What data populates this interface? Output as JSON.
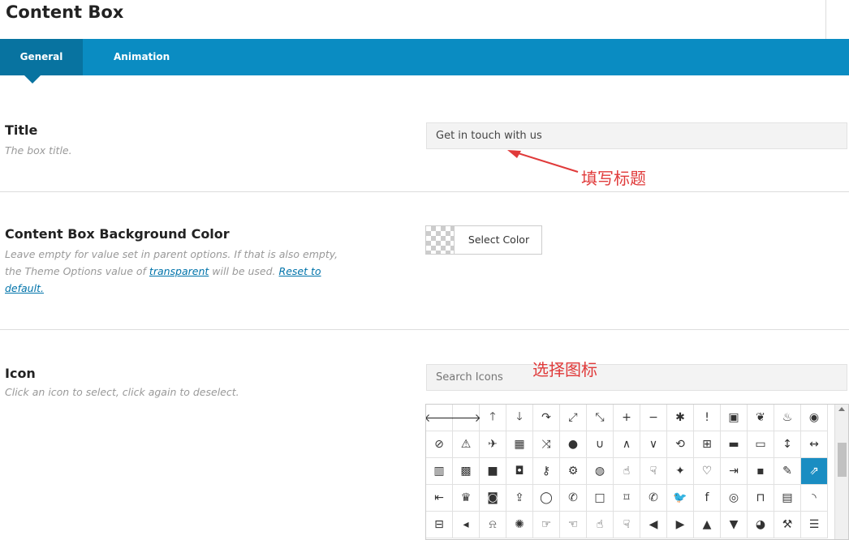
{
  "page": {
    "title": "Content Box"
  },
  "tabs": [
    {
      "label": "General",
      "active": true
    },
    {
      "label": "Animation",
      "active": false
    }
  ],
  "title_section": {
    "heading": "Title",
    "description": "The box title.",
    "value": "Get in touch with us",
    "annotation": "填写标题"
  },
  "bg_section": {
    "heading": "Content Box Background Color",
    "desc_part1": "Leave empty for value set in parent options. If that is also empty, the Theme Options value of ",
    "desc_link1": "transparent",
    "desc_part2": " will be used. ",
    "desc_link2": "Reset to default.",
    "button_label": "Select Color"
  },
  "icon_section": {
    "heading": "Icon",
    "description": "Click an icon to select, click again to deselect.",
    "search_placeholder": "Search Icons",
    "annotation": "选择图标",
    "selected_index": 44,
    "icons": [
      {
        "name": "arrow-left-icon",
        "glyph": "🡐"
      },
      {
        "name": "arrow-right-icon",
        "glyph": "🡒"
      },
      {
        "name": "arrow-up-icon",
        "glyph": "🡑"
      },
      {
        "name": "arrow-down-icon",
        "glyph": "🡓"
      },
      {
        "name": "share-icon",
        "glyph": "↷"
      },
      {
        "name": "expand-icon",
        "glyph": "⤢"
      },
      {
        "name": "compress-icon",
        "glyph": "⤡"
      },
      {
        "name": "plus-icon",
        "glyph": "+"
      },
      {
        "name": "minus-icon",
        "glyph": "−"
      },
      {
        "name": "asterisk-icon",
        "glyph": "✱"
      },
      {
        "name": "exclamation-circle-icon",
        "glyph": "!"
      },
      {
        "name": "gift-icon",
        "glyph": "▣"
      },
      {
        "name": "leaf-icon",
        "glyph": "❦"
      },
      {
        "name": "fire-icon",
        "glyph": "♨"
      },
      {
        "name": "eye-icon",
        "glyph": "◉"
      },
      {
        "name": "eye-slash-icon",
        "glyph": "⊘"
      },
      {
        "name": "warning-icon",
        "glyph": "⚠"
      },
      {
        "name": "plane-icon",
        "glyph": "✈"
      },
      {
        "name": "calendar-icon",
        "glyph": "▦"
      },
      {
        "name": "random-icon",
        "glyph": "⤨"
      },
      {
        "name": "comment-icon",
        "glyph": "●"
      },
      {
        "name": "magnet-icon",
        "glyph": "∪"
      },
      {
        "name": "chevron-up-icon",
        "glyph": "∧"
      },
      {
        "name": "chevron-down-icon",
        "glyph": "∨"
      },
      {
        "name": "retweet-icon",
        "glyph": "⟲"
      },
      {
        "name": "shopping-cart-icon",
        "glyph": "⊞"
      },
      {
        "name": "folder-icon",
        "glyph": "▬"
      },
      {
        "name": "folder-open-icon",
        "glyph": "▭"
      },
      {
        "name": "arrows-v-icon",
        "glyph": "↕"
      },
      {
        "name": "arrows-h-icon",
        "glyph": "↔"
      },
      {
        "name": "bar-chart-icon",
        "glyph": "▥"
      },
      {
        "name": "twitter-square-icon",
        "glyph": "▩"
      },
      {
        "name": "facebook-square-icon",
        "glyph": "■"
      },
      {
        "name": "camera-retro-icon",
        "glyph": "◘"
      },
      {
        "name": "key-icon",
        "glyph": "⚷"
      },
      {
        "name": "cogs-icon",
        "glyph": "⚙"
      },
      {
        "name": "comments-icon",
        "glyph": "◍"
      },
      {
        "name": "thumbs-o-up-icon",
        "glyph": "☝"
      },
      {
        "name": "thumbs-o-down-icon",
        "glyph": "☟"
      },
      {
        "name": "star-half-icon",
        "glyph": "✦"
      },
      {
        "name": "heart-o-icon",
        "glyph": "♡"
      },
      {
        "name": "sign-out-icon",
        "glyph": "⇥"
      },
      {
        "name": "linkedin-square-icon",
        "glyph": "▪"
      },
      {
        "name": "thumb-tack-icon",
        "glyph": "✎"
      },
      {
        "name": "external-link-icon",
        "glyph": "⇗"
      },
      {
        "name": "sign-in-icon",
        "glyph": "⇤"
      },
      {
        "name": "trophy-icon",
        "glyph": "♛"
      },
      {
        "name": "github-square-icon",
        "glyph": "◙"
      },
      {
        "name": "upload-icon",
        "glyph": "⇪"
      },
      {
        "name": "lemon-icon",
        "glyph": "◯"
      },
      {
        "name": "phone-icon",
        "glyph": "✆"
      },
      {
        "name": "square-o-icon",
        "glyph": "□"
      },
      {
        "name": "bookmark-o-icon",
        "glyph": "⌑"
      },
      {
        "name": "phone-square-icon",
        "glyph": "✆"
      },
      {
        "name": "twitter-icon",
        "glyph": "🐦"
      },
      {
        "name": "facebook-icon",
        "glyph": "f"
      },
      {
        "name": "github-icon",
        "glyph": "◎"
      },
      {
        "name": "unlock-icon",
        "glyph": "⊓"
      },
      {
        "name": "credit-card-icon",
        "glyph": "▤"
      },
      {
        "name": "rss-icon",
        "glyph": "◝"
      },
      {
        "name": "hdd-icon",
        "glyph": "⊟"
      },
      {
        "name": "bullhorn-icon",
        "glyph": "◂"
      },
      {
        "name": "bell-icon",
        "glyph": "⍾"
      },
      {
        "name": "certificate-icon",
        "glyph": "✺"
      },
      {
        "name": "hand-o-right-icon",
        "glyph": "☞"
      },
      {
        "name": "hand-o-left-icon",
        "glyph": "☜"
      },
      {
        "name": "hand-o-up-icon",
        "glyph": "☝"
      },
      {
        "name": "hand-o-down-icon",
        "glyph": "☟"
      },
      {
        "name": "arrow-circle-left-icon",
        "glyph": "◀"
      },
      {
        "name": "arrow-circle-right-icon",
        "glyph": "▶"
      },
      {
        "name": "arrow-circle-up-icon",
        "glyph": "▲"
      },
      {
        "name": "arrow-circle-down-icon",
        "glyph": "▼"
      },
      {
        "name": "globe-icon",
        "glyph": "◕"
      },
      {
        "name": "wrench-icon",
        "glyph": "⚒"
      },
      {
        "name": "tasks-icon",
        "glyph": "☰"
      }
    ]
  },
  "colors": {
    "tabbar": "#0a8cc2",
    "tab_active": "#0873a0",
    "selected": "#1a8dc2",
    "annotation": "#e03a3a",
    "link": "#0073aa"
  }
}
